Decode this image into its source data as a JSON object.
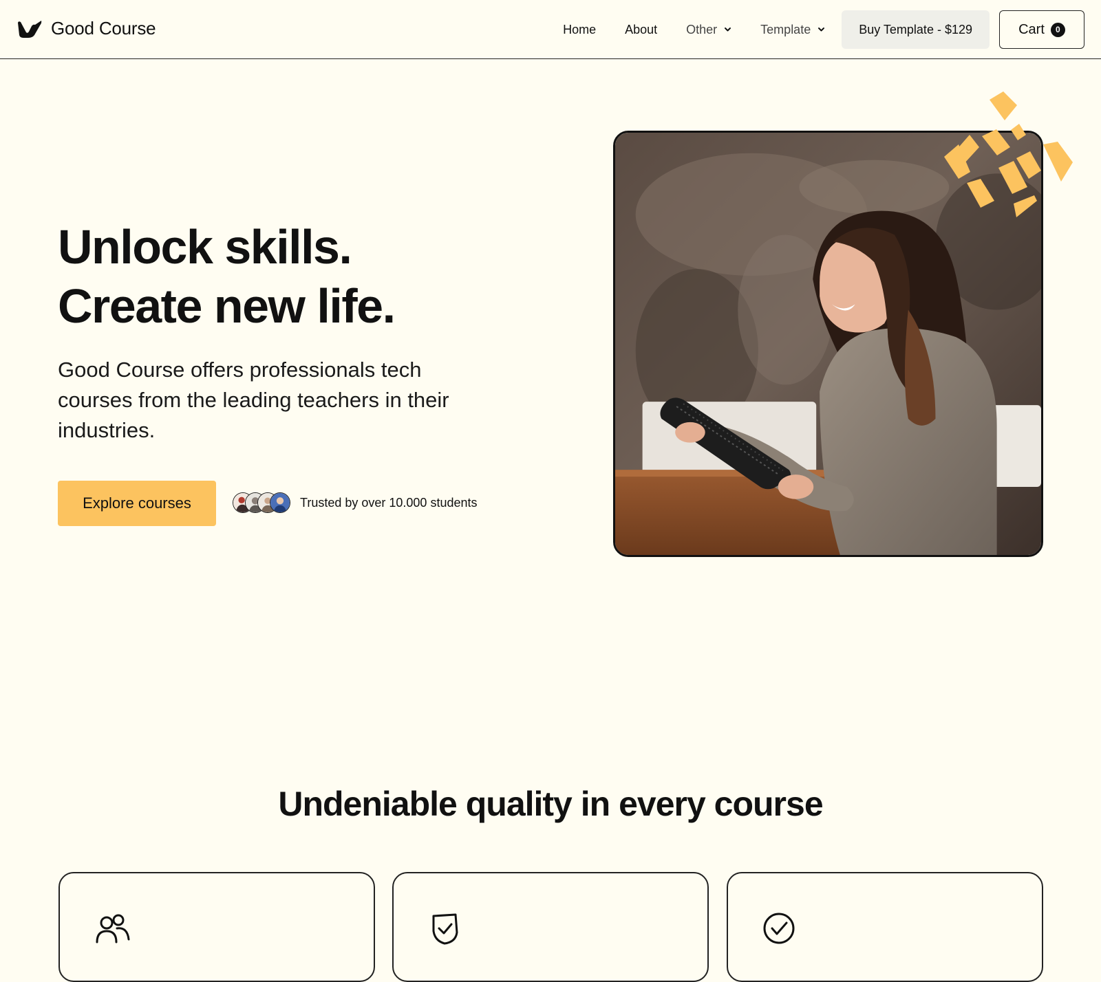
{
  "brand": {
    "name": "Good Course",
    "logo_icon": "bird-icon"
  },
  "nav": {
    "home": "Home",
    "about": "About",
    "other": "Other",
    "template": "Template",
    "buy_label": "Buy Template - $129",
    "cart_label": "Cart",
    "cart_count": "0"
  },
  "hero": {
    "title_line1": "Unlock skills.",
    "title_line2": "Create new life.",
    "description": "Good Course offers professionals tech courses from the leading teachers in their industries.",
    "cta_label": "Explore courses",
    "trust_text": "Trusted by over 10.000 students",
    "accent_color": "#fcc35f",
    "photo_icon": "woman-with-tablet-photo"
  },
  "features": {
    "title": "Undeniable quality in every course",
    "cards": [
      {
        "icon": "users-icon"
      },
      {
        "icon": "shield-check-icon"
      },
      {
        "icon": "check-circle-icon"
      }
    ]
  }
}
